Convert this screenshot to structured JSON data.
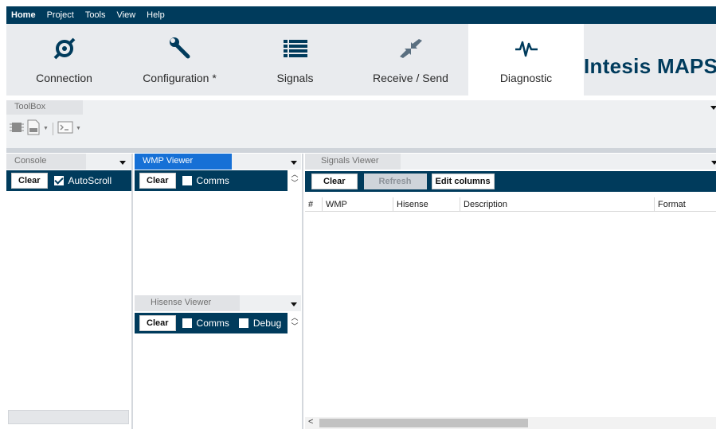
{
  "menu": [
    "Home",
    "Project",
    "Tools",
    "View",
    "Help"
  ],
  "ribbon": {
    "tabs": [
      {
        "label": "Connection",
        "icon": "connection-icon"
      },
      {
        "label": "Configuration *",
        "icon": "wrench-icon"
      },
      {
        "label": "Signals",
        "icon": "list-icon"
      },
      {
        "label": "Receive / Send",
        "icon": "receive-send-icon"
      },
      {
        "label": "Diagnostic",
        "icon": "pulse-icon"
      }
    ],
    "selected": "Diagnostic",
    "brand": "Intesis MAPS"
  },
  "toolbox": {
    "title": "ToolBox"
  },
  "console": {
    "title": "Console",
    "clear": "Clear",
    "autoscroll": "AutoScroll"
  },
  "wmp_viewer": {
    "title": "WMP Viewer",
    "clear": "Clear",
    "comms": "Comms"
  },
  "hisense_viewer": {
    "title": "Hisense Viewer",
    "clear": "Clear",
    "comms": "Comms",
    "debug": "Debug"
  },
  "signals_viewer": {
    "title": "Signals Viewer",
    "clear": "Clear",
    "refresh": "Refresh",
    "edit_columns": "Edit columns",
    "columns": [
      "#",
      "WMP",
      "Hisense",
      "Description",
      "Format"
    ]
  },
  "colors": {
    "navy": "#003b5c",
    "active_tab": "#1670d6",
    "ribbon_bg": "#e9ebee"
  }
}
